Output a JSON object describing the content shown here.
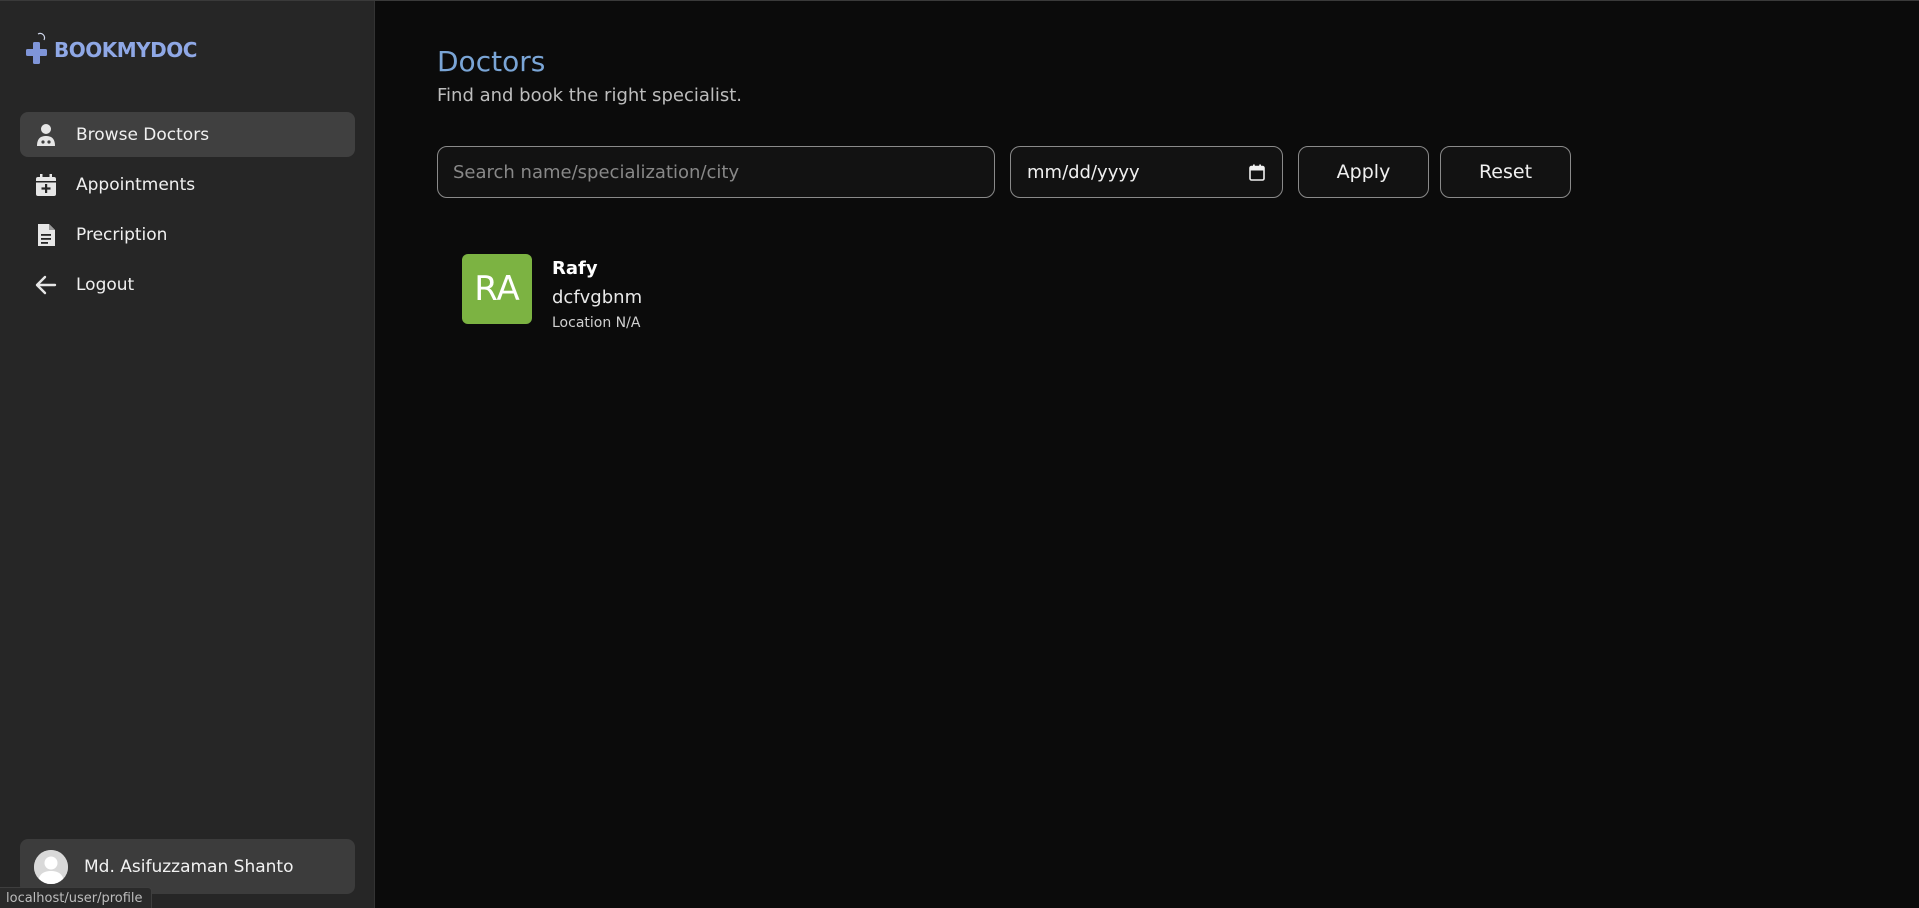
{
  "brand": {
    "name": "BOOKMYDOC",
    "accent": "#8fa8e6"
  },
  "sidebar": {
    "items": [
      {
        "label": "Browse Doctors",
        "icon": "doctor-icon",
        "active": true
      },
      {
        "label": "Appointments",
        "icon": "calendar-plus-icon",
        "active": false
      },
      {
        "label": "Precription",
        "icon": "document-icon",
        "active": false
      },
      {
        "label": "Logout",
        "icon": "arrow-left-icon",
        "active": false
      }
    ],
    "profile": {
      "name": "Md. Asifuzzaman Shanto",
      "icon": "user-avatar-icon"
    }
  },
  "status_bar": {
    "url": "localhost/user/profile"
  },
  "main": {
    "title": "Doctors",
    "subtitle": "Find and book the right specialist.",
    "title_color": "#7aa5d6"
  },
  "filters": {
    "search_placeholder": "Search name/specialization/city",
    "search_value": "",
    "date_placeholder": "mm/dd/yyyy",
    "apply_label": "Apply",
    "reset_label": "Reset"
  },
  "doctors": [
    {
      "initials": "RA",
      "name": "Rafy",
      "specialization": "dcfvgbnm",
      "location": "Location N/A",
      "avatar_color": "#7cb342"
    }
  ]
}
